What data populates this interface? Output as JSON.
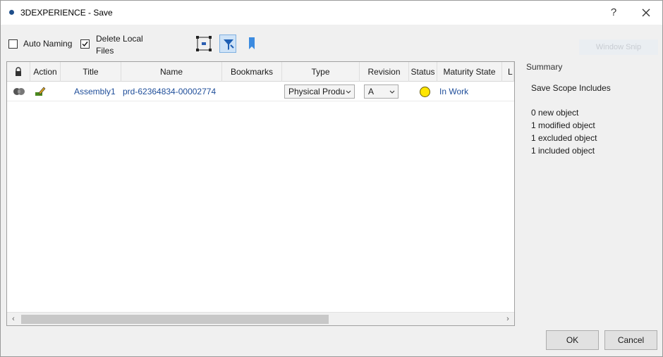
{
  "window": {
    "title": "3DEXPERIENCE - Save",
    "help_label": "?"
  },
  "toolbar": {
    "auto_naming": {
      "label": "Auto Naming",
      "checked": false
    },
    "delete_local_files": {
      "label_line1": "Delete Local",
      "label_line2": "Files",
      "checked": true
    },
    "ghost_button_label": "Window Snip"
  },
  "grid": {
    "columns": [
      "",
      "Action",
      "Title",
      "Name",
      "Bookmarks",
      "Type",
      "Revision",
      "Status",
      "Maturity State",
      "L"
    ],
    "rows": [
      {
        "title": "Assembly1",
        "name": "prd-62364834-00002774",
        "bookmarks": "",
        "type": "Physical Produ",
        "revision": "A",
        "status_color": "#ffe600",
        "maturity_state": "In Work"
      }
    ]
  },
  "summary": {
    "title": "Summary",
    "heading": "Save Scope Includes",
    "lines": [
      "0 new object",
      "1 modified object",
      "1 excluded object",
      "1 included object"
    ]
  },
  "buttons": {
    "ok": "OK",
    "cancel": "Cancel"
  },
  "colors": {
    "link": "#1f4e9a",
    "accent": "#1f4e8a"
  }
}
